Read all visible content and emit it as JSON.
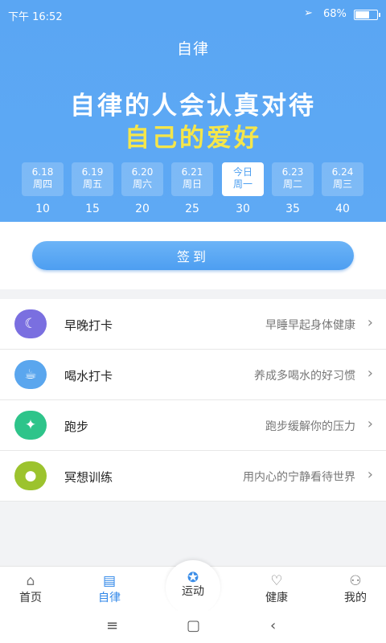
{
  "status_bar": {
    "time": "下午 16:52",
    "battery_percent": "68%",
    "battery_level": 0.68,
    "nav_icon": "location-arrow-icon"
  },
  "header": {
    "title": "自律"
  },
  "banner": {
    "line1": "自律的人会认真对待",
    "line2": "自己的爱好",
    "line2_color": "#f5e64a"
  },
  "days": [
    {
      "date": "6.18",
      "weekday": "周四",
      "value": "10"
    },
    {
      "date": "6.19",
      "weekday": "周五",
      "value": "15"
    },
    {
      "date": "6.20",
      "weekday": "周六",
      "value": "20"
    },
    {
      "date": "6.21",
      "weekday": "周日",
      "value": "25"
    },
    {
      "date": "今日",
      "weekday": "周一",
      "value": "30"
    },
    {
      "date": "6.23",
      "weekday": "周二",
      "value": "35"
    },
    {
      "date": "6.24",
      "weekday": "周三",
      "value": "40"
    }
  ],
  "sign_in": {
    "label": "签到"
  },
  "items": [
    {
      "name": "早晚打卡",
      "desc": "早睡早起身体健康",
      "icon": "moon-icon",
      "color": "#7a6fe0"
    },
    {
      "name": "喝水打卡",
      "desc": "养成多喝水的好习惯",
      "icon": "cup-icon",
      "color": "#5aa6ee"
    },
    {
      "name": "跑步",
      "desc": "跑步缓解你的压力",
      "icon": "runner-icon",
      "color": "#2ec48a"
    },
    {
      "name": "冥想训练",
      "desc": "用内心的宁静看待世界",
      "icon": "lightbulb-icon",
      "color": "#9cc32e"
    }
  ],
  "tabs": [
    {
      "label": "首页",
      "icon": "home-icon"
    },
    {
      "label": "自律",
      "icon": "book-icon"
    },
    {
      "label": "运动",
      "icon": "sport-runner-icon"
    },
    {
      "label": "健康",
      "icon": "heart-icon"
    },
    {
      "label": "我的",
      "icon": "person-icon"
    }
  ],
  "accent_color": "#5aa6f3"
}
